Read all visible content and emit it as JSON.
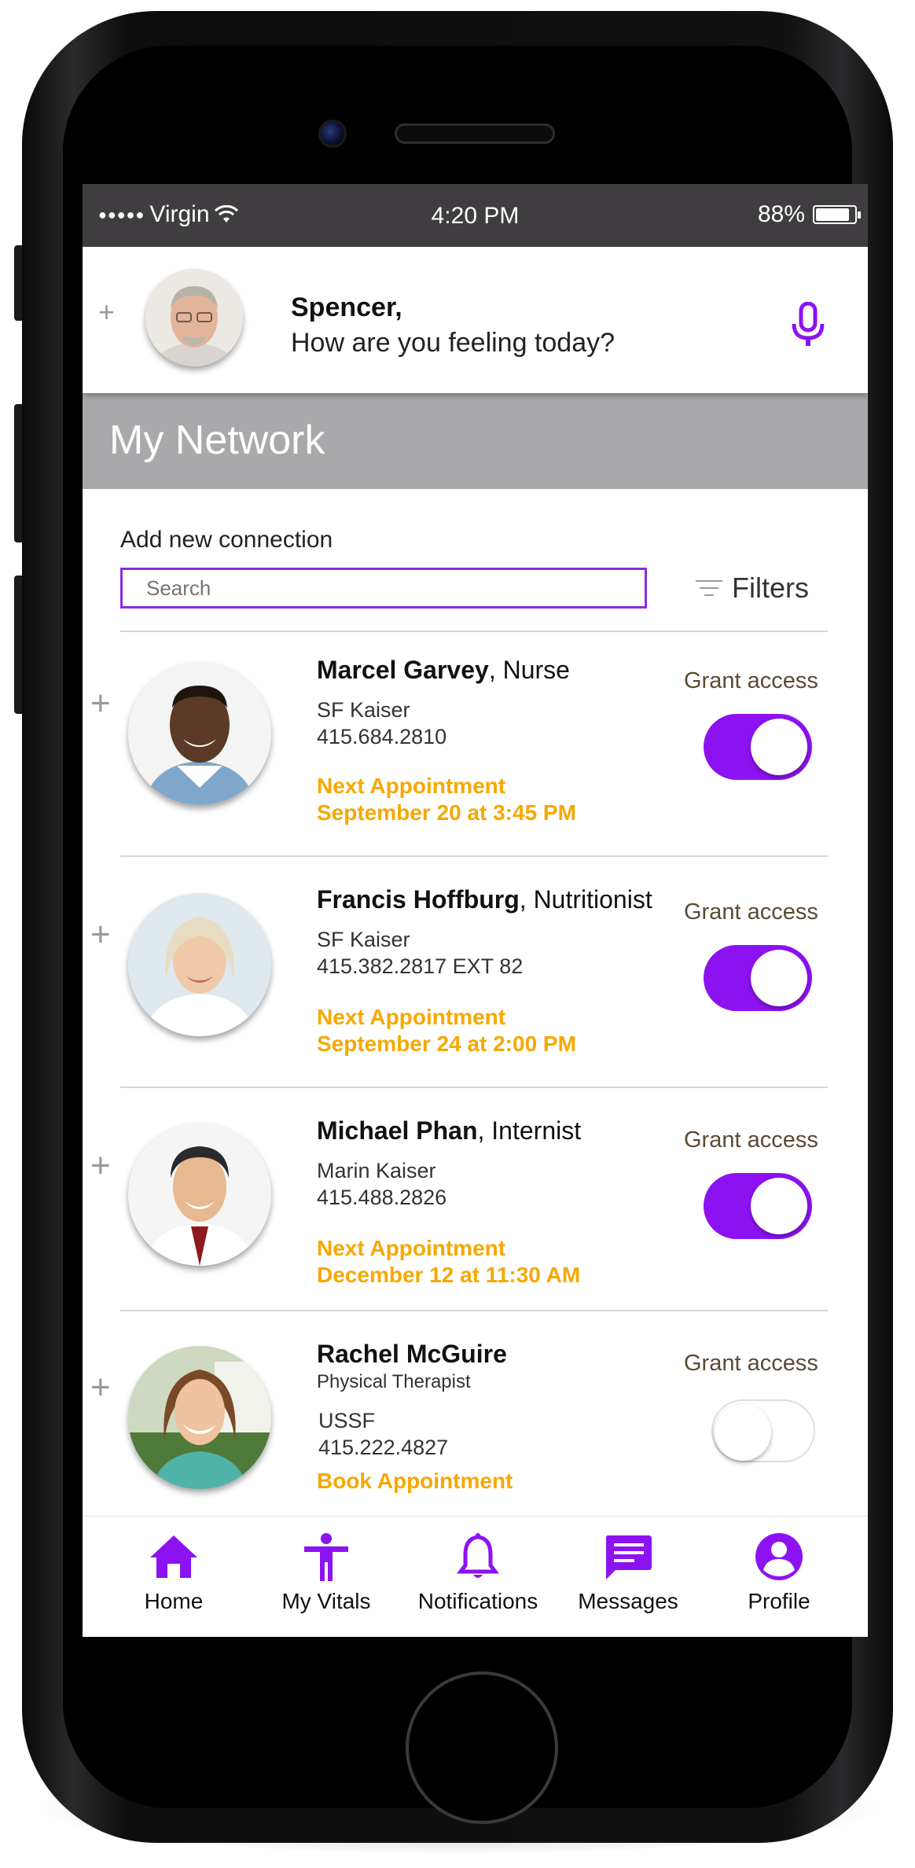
{
  "status_bar": {
    "carrier": "Virgin",
    "time": "4:20 PM",
    "battery": "88%",
    "battery_level": 0.88
  },
  "greeting": {
    "name": "Spencer,",
    "question": "How are you feeling today?"
  },
  "section": {
    "title": "My Network"
  },
  "search": {
    "add_label": "Add new connection",
    "placeholder": "Search",
    "filters_label": "Filters"
  },
  "contacts": [
    {
      "name": "Marcel Garvey",
      "role": ", Nurse",
      "org": "SF Kaiser",
      "phone": "415.684.2810",
      "appt_label": "Next Appointment",
      "appt_date": "September 20 at 3:45 PM",
      "grant_label": "Grant access",
      "access": true
    },
    {
      "name": "Francis Hoffburg",
      "role": ", Nutritionist",
      "org": "SF Kaiser",
      "phone": "415.382.2817 EXT 82",
      "appt_label": "Next Appointment",
      "appt_date": "September 24 at 2:00 PM",
      "grant_label": "Grant access",
      "access": true
    },
    {
      "name": "Michael Phan",
      "role": ", Internist",
      "org": "Marin Kaiser",
      "phone": "415.488.2826",
      "appt_label": "Next Appointment",
      "appt_date": "December 12 at 11:30 AM",
      "grant_label": "Grant access",
      "access": true
    },
    {
      "name": "Rachel McGuire",
      "title": "Physical Therapist",
      "org": "USSF",
      "phone": "415.222.4827",
      "book_label": "Book Appointment",
      "grant_label": "Grant access",
      "access": false
    }
  ],
  "tabs": [
    {
      "label": "Home",
      "icon": "home-icon"
    },
    {
      "label": "My Vitals",
      "icon": "person-icon"
    },
    {
      "label": "Notifications",
      "icon": "bell-icon"
    },
    {
      "label": "Messages",
      "icon": "message-icon"
    },
    {
      "label": "Profile",
      "icon": "profile-icon"
    }
  ],
  "colors": {
    "accent": "#8d12f2",
    "appointment": "#f5a800",
    "status_bar": "#403d40",
    "section_header": "#a9a8ab"
  }
}
